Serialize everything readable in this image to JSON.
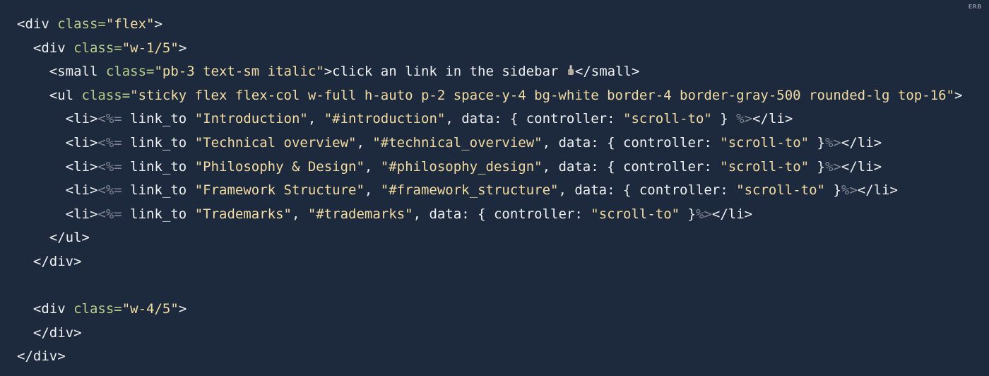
{
  "badge": "ERB",
  "code": {
    "line1": {
      "a": "<div ",
      "attr": "class=",
      "str": "\"flex\"",
      "b": ">"
    },
    "line2": {
      "a": "<div ",
      "attr": "class=",
      "str": "\"w-1/5\"",
      "b": ">"
    },
    "line3": {
      "a": "<small ",
      "attr": "class=",
      "str": "\"pb-3 text-sm italic\"",
      "b": ">click an link in the sidebar ",
      "c": "</small>"
    },
    "line4": {
      "a": "<ul ",
      "attr": "class=",
      "str": "\"sticky flex flex-col w-full h-auto p-2 space-y-4 bg-white border-4 border-gray-500 rounded-lg top-16\"",
      "b": ">"
    },
    "line5": {
      "li_open": "<li>",
      "erb_open": "<%=",
      "code": " link_to ",
      "s1": "\"Introduction\"",
      "sep1": ", ",
      "s2": "\"#introduction\"",
      "sep2": ", data: { controller: ",
      "s3": "\"scroll-to\"",
      "close": " } ",
      "erb_close": "%>",
      "li_close": "</li>"
    },
    "line6": {
      "li_open": "<li>",
      "erb_open": "<%=",
      "code": " link_to ",
      "s1": "\"Technical overview\"",
      "sep1": ", ",
      "s2": "\"#technical_overview\"",
      "sep2": ", data: { controller: ",
      "s3": "\"scroll-to\"",
      "close": " }",
      "erb_close": "%>",
      "li_close": "</li>"
    },
    "line7": {
      "li_open": "<li>",
      "erb_open": "<%=",
      "code": " link_to ",
      "s1": "\"Philosophy & Design\"",
      "sep1": ", ",
      "s2": "\"#philosophy_design\"",
      "sep2": ", data: { controller: ",
      "s3": "\"scroll-to\"",
      "close": " }",
      "erb_close": "%>",
      "li_close": "</li>"
    },
    "line8": {
      "li_open": "<li>",
      "erb_open": "<%=",
      "code": " link_to ",
      "s1": "\"Framework Structure\"",
      "sep1": ", ",
      "s2": "\"#framework_structure\"",
      "sep2": ", data: { controller: ",
      "s3": "\"scroll-to\"",
      "close": " }",
      "erb_close": "%>",
      "li_close": "</li>"
    },
    "line9": {
      "li_open": "<li>",
      "erb_open": "<%=",
      "code": " link_to ",
      "s1": "\"Trademarks\"",
      "sep1": ", ",
      "s2": "\"#trademarks\"",
      "sep2": ", data: { controller: ",
      "s3": "\"scroll-to\"",
      "close": " }",
      "erb_close": "%>",
      "li_close": "</li>"
    },
    "line10": {
      "a": "</ul>"
    },
    "line11": {
      "a": "</div>"
    },
    "line12": {
      "a": ""
    },
    "line13": {
      "a": "<div ",
      "attr": "class=",
      "str": "\"w-4/5\"",
      "b": ">"
    },
    "line14": {
      "a": "</div>"
    },
    "line15": {
      "a": "</div>"
    }
  }
}
